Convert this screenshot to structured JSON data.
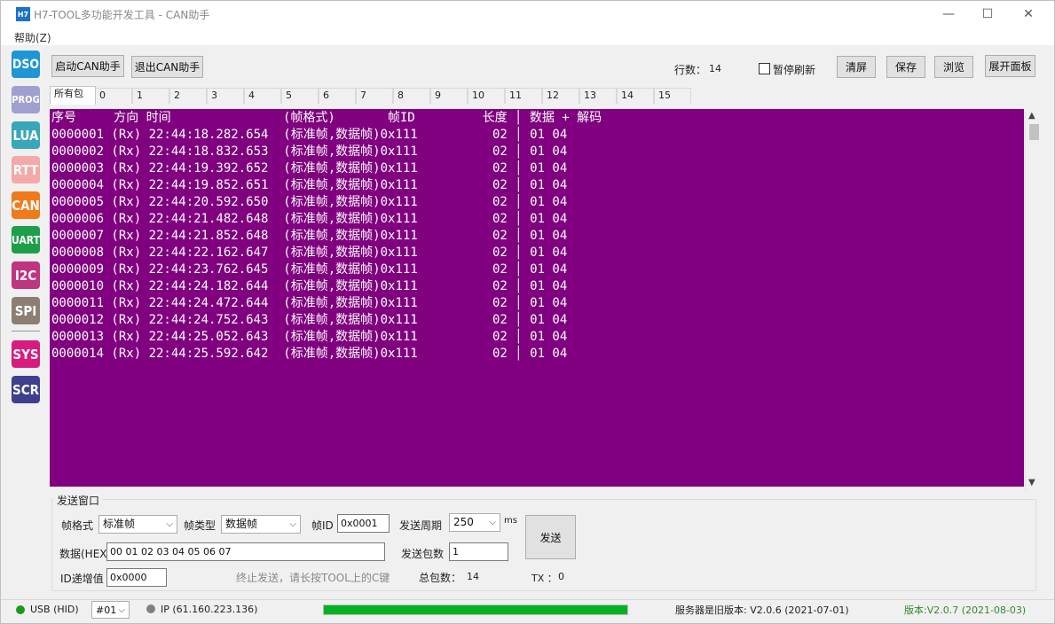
{
  "window": {
    "app_icon_text": "H7",
    "title": "H7-TOOL多功能开发工具 - CAN助手",
    "controls": {
      "minimize": "—",
      "maximize": "☐",
      "close": "✕"
    }
  },
  "menu": {
    "help": "帮助(Z)"
  },
  "sidebar": [
    {
      "label": "DSO",
      "color": "#1e96d4"
    },
    {
      "label": "PROG",
      "color": "#9f9fd0"
    },
    {
      "label": "LUA",
      "color": "#3aa6b9"
    },
    {
      "label": "RTT",
      "color": "#f4a8a8"
    },
    {
      "label": "CAN",
      "color": "#f07a1a"
    },
    {
      "label": "UART",
      "color": "#1f9e4a"
    },
    {
      "label": "I2C",
      "color": "#c0357f"
    },
    {
      "label": "SPI",
      "color": "#8a7f72"
    },
    {
      "label": "SYS",
      "color": "#d81b7f"
    },
    {
      "label": "SCR",
      "color": "#3f3f8f"
    }
  ],
  "toolbar": {
    "start_label": "启动CAN助手",
    "exit_label": "退出CAN助手",
    "row_count_label": "行数：",
    "row_count_value": "14",
    "pause_label": "暂停刷新",
    "clear_label": "清屏",
    "save_label": "保存",
    "browse_label": "浏览",
    "expand_label": "展开面板"
  },
  "tabs": [
    "所有包",
    "0",
    "1",
    "2",
    "3",
    "4",
    "5",
    "6",
    "7",
    "8",
    "9",
    "10",
    "11",
    "12",
    "13",
    "14",
    "15"
  ],
  "terminal": {
    "header": "序号     方向 时间               (帧格式)       帧ID         长度 │ 数据 + 解码",
    "rows": [
      "0000001 (Rx) 22:44:18.282.654  (标准帧,数据帧)0x111          02 │ 01 04",
      "0000002 (Rx) 22:44:18.832.653  (标准帧,数据帧)0x111          02 │ 01 04",
      "0000003 (Rx) 22:44:19.392.652  (标准帧,数据帧)0x111          02 │ 01 04",
      "0000004 (Rx) 22:44:19.852.651  (标准帧,数据帧)0x111          02 │ 01 04",
      "0000005 (Rx) 22:44:20.592.650  (标准帧,数据帧)0x111          02 │ 01 04",
      "0000006 (Rx) 22:44:21.482.648  (标准帧,数据帧)0x111          02 │ 01 04",
      "0000007 (Rx) 22:44:21.852.648  (标准帧,数据帧)0x111          02 │ 01 04",
      "0000008 (Rx) 22:44:22.162.647  (标准帧,数据帧)0x111          02 │ 01 04",
      "0000009 (Rx) 22:44:23.762.645  (标准帧,数据帧)0x111          02 │ 01 04",
      "0000010 (Rx) 22:44:24.182.644  (标准帧,数据帧)0x111          02 │ 01 04",
      "0000011 (Rx) 22:44:24.472.644  (标准帧,数据帧)0x111          02 │ 01 04",
      "0000012 (Rx) 22:44:24.752.643  (标准帧,数据帧)0x111          02 │ 01 04",
      "0000013 (Rx) 22:44:25.052.643  (标准帧,数据帧)0x111          02 │ 01 04",
      "0000014 (Rx) 22:44:25.592.642  (标准帧,数据帧)0x111          02 │ 01 04"
    ]
  },
  "send": {
    "group_title": "发送窗口",
    "frame_format_label": "帧格式",
    "frame_format_value": "标准帧",
    "frame_type_label": "帧类型",
    "frame_type_value": "数据帧",
    "frame_id_label": "帧ID",
    "frame_id_value": "0x0001",
    "period_label": "发送周期",
    "period_value": "250",
    "period_unit": "ms",
    "send_label": "发送",
    "data_label": "数据(HEX)",
    "data_value": "00 01 02 03 04 05 06 07",
    "count_label": "发送包数",
    "count_value": "1",
    "id_inc_label": "ID递增值",
    "id_inc_value": "0x0000",
    "hint": "终止发送，请长按TOOL上的C键",
    "total_label": "总包数：",
    "total_value": "14",
    "tx_label": "TX ：",
    "tx_value": "0"
  },
  "status": {
    "usb_label": "USB (HID)",
    "usb_dot_color": "#1a9a1a",
    "device_value": "#01",
    "ip_label": "IP (61.160.223.136)",
    "ip_dot_color": "#808080",
    "progress": 1.0,
    "server_version": "服务器是旧版本: V2.0.6 (2021-07-01)",
    "local_version": "版本:V2.0.7 (2021-08-03)",
    "local_version_color": "#2e8b2e"
  }
}
